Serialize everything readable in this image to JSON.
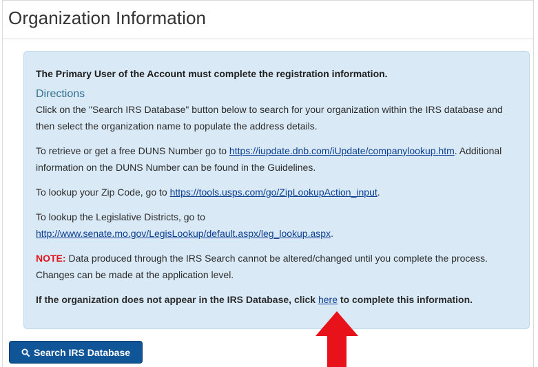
{
  "page": {
    "title": "Organization Information"
  },
  "info": {
    "lead": "The Primary User of the Account must complete the registration information.",
    "directions_heading": "Directions",
    "para1": "Click on the \"Search IRS Database\" button below to search for your organization within the IRS database and then select the organization name to populate the address details.",
    "duns_prefix": "To retrieve or get a free DUNS Number go to ",
    "duns_link": "https://iupdate.dnb.com/iUpdate/companylookup.htm",
    "duns_suffix": ". Additional information on the DUNS Number can be found in the Guidelines.",
    "zip_prefix": "To lookup your Zip Code, go to ",
    "zip_link": "https://tools.usps.com/go/ZipLookupAction_input",
    "zip_suffix": ".",
    "leg_prefix": "To lookup the Legislative Districts, go to",
    "leg_link": "http://www.senate.mo.gov/LegisLookup/default.aspx/leg_lookup.aspx",
    "leg_suffix": ".",
    "note_label": "NOTE:",
    "note_text": " Data produced through the IRS Search cannot be altered/changed until you complete the process. Changes can be made at the application level.",
    "final_prefix": "If the organization does not appear in the IRS Database, click ",
    "final_link": "here",
    "final_suffix": " to complete this information."
  },
  "actions": {
    "search_button": "Search IRS Database",
    "search_icon": "search-icon"
  },
  "colors": {
    "info_bg": "#d9eaf6",
    "button_bg": "#115599",
    "note_red": "#e0121a",
    "arrow_red": "#e8121a",
    "link": "#0b3d91"
  }
}
